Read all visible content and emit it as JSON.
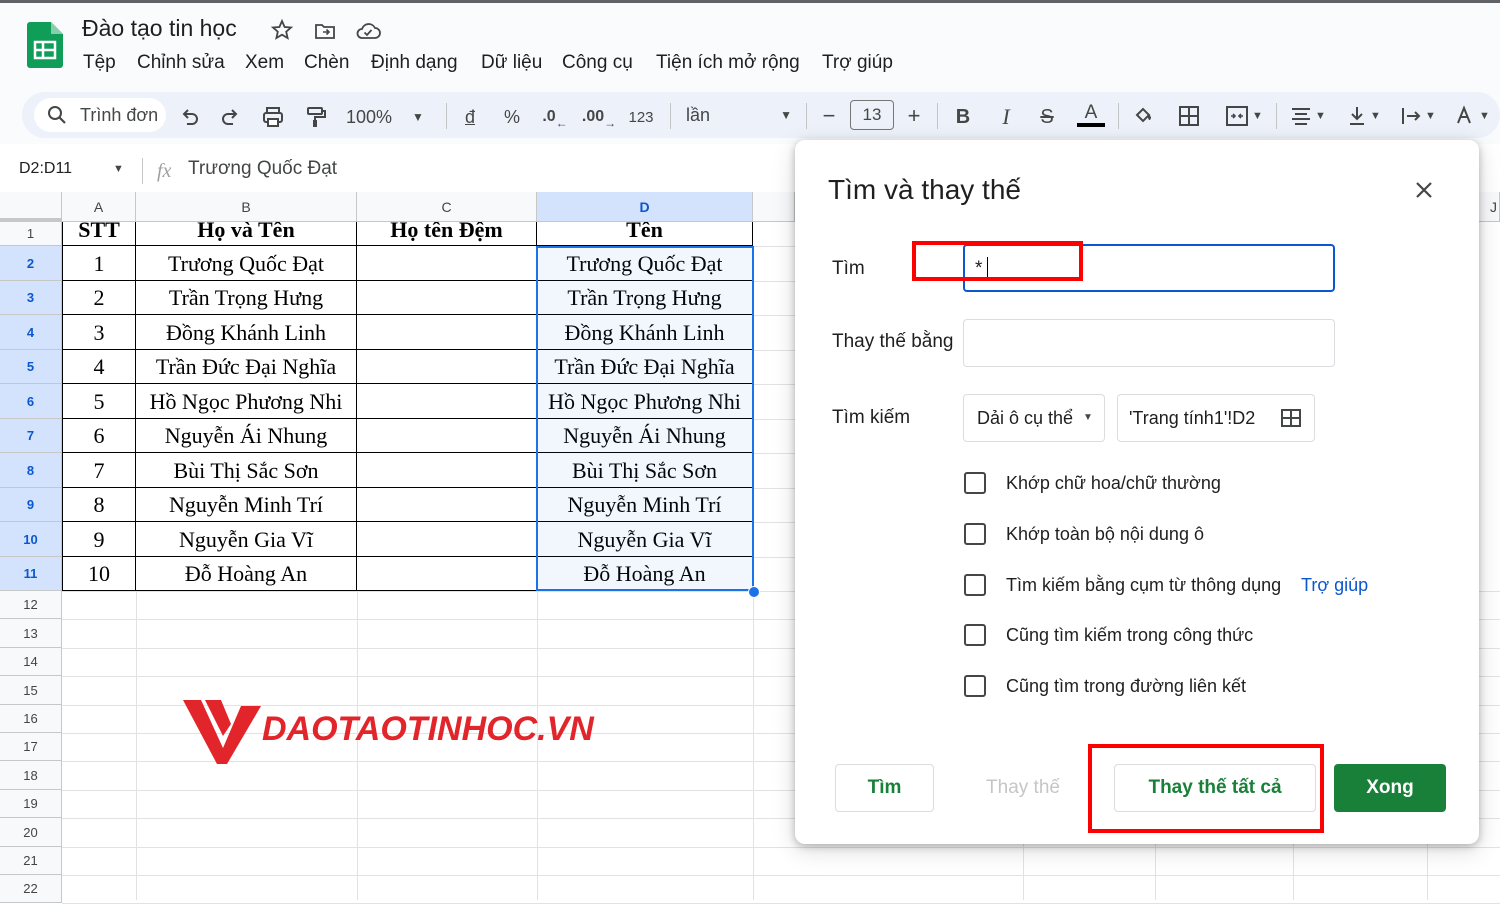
{
  "app": {
    "doc_title": "Đào tạo tin học",
    "menu": [
      "Tệp",
      "Chỉnh sửa",
      "Xem",
      "Chèn",
      "Định dạng",
      "Dữ liệu",
      "Công cụ",
      "Tiện ích mở rộng",
      "Trợ giúp"
    ]
  },
  "toolbar": {
    "search_menus": "Trình đơn",
    "zoom": "100%",
    "currency": "đ",
    "percent": "%",
    "dec_decrease": ".0",
    "dec_increase": ".00",
    "number_format": "123",
    "font": "lần",
    "font_size": "13",
    "minus": "−",
    "plus": "+",
    "bold": "B",
    "italic": "I",
    "strike": "S",
    "text_color": "A",
    "text_color_hex": "#000000"
  },
  "formula_bar": {
    "name_box": "D2:D11",
    "fx": "fx",
    "content": "Trương Quốc Đạt"
  },
  "sheet": {
    "columns": [
      "A",
      "B",
      "C",
      "D"
    ],
    "next_column": "J",
    "row_numbers": [
      "1",
      "2",
      "3",
      "4",
      "5",
      "6",
      "7",
      "8",
      "9",
      "10",
      "11",
      "12",
      "13",
      "14",
      "15",
      "16",
      "17",
      "18",
      "19",
      "20",
      "21",
      "22"
    ],
    "header": [
      "STT",
      "Họ và Tên",
      "Họ tên Đệm",
      "Tên"
    ],
    "rows": [
      [
        "1",
        "Trương Quốc Đạt",
        "",
        "Trương Quốc Đạt"
      ],
      [
        "2",
        "Trần Trọng Hưng",
        "",
        "Trần Trọng Hưng"
      ],
      [
        "3",
        "Đồng Khánh Linh",
        "",
        "Đồng Khánh Linh"
      ],
      [
        "4",
        "Trần Đức Đại Nghĩa",
        "",
        "Trần Đức Đại Nghĩa"
      ],
      [
        "5",
        "Hồ Ngọc Phương Nhi",
        "",
        "Hồ Ngọc Phương Nhi"
      ],
      [
        "6",
        "Nguyễn Ái Nhung",
        "",
        "Nguyễn Ái Nhung"
      ],
      [
        "7",
        "Bùi Thị Sắc Sơn",
        "",
        "Bùi Thị Sắc Sơn"
      ],
      [
        "8",
        "Nguyễn Minh Trí",
        "",
        "Nguyễn Minh Trí"
      ],
      [
        "9",
        "Nguyễn Gia Vĩ",
        "",
        "Nguyễn Gia Vĩ"
      ],
      [
        "10",
        "Đỗ Hoàng An",
        "",
        "Đỗ Hoàng An"
      ]
    ]
  },
  "watermark": {
    "text": "DAOTAOTINHOC.VN"
  },
  "dialog": {
    "title": "Tìm và thay thế",
    "find_label": "Tìm",
    "find_value": "*",
    "replace_label": "Thay thế bằng",
    "replace_value": "",
    "search_label": "Tìm kiếm",
    "search_scope": "Dải ô cụ thể",
    "range": "'Trang tính1'!D2",
    "options": [
      "Khớp chữ hoa/chữ thường",
      "Khớp toàn bộ nội dung ô",
      "Tìm kiếm bằng cụm từ thông dụng",
      "Cũng tìm kiếm trong công thức",
      "Cũng tìm trong đường liên kết"
    ],
    "help_link": "Trợ giúp",
    "buttons": {
      "find": "Tìm",
      "replace": "Thay thế",
      "replace_all": "Thay thế tất cả",
      "done": "Xong"
    }
  },
  "colors": {
    "accent_green": "#188038",
    "highlight_red": "#ff0000",
    "selection_blue": "#1a73e8"
  }
}
